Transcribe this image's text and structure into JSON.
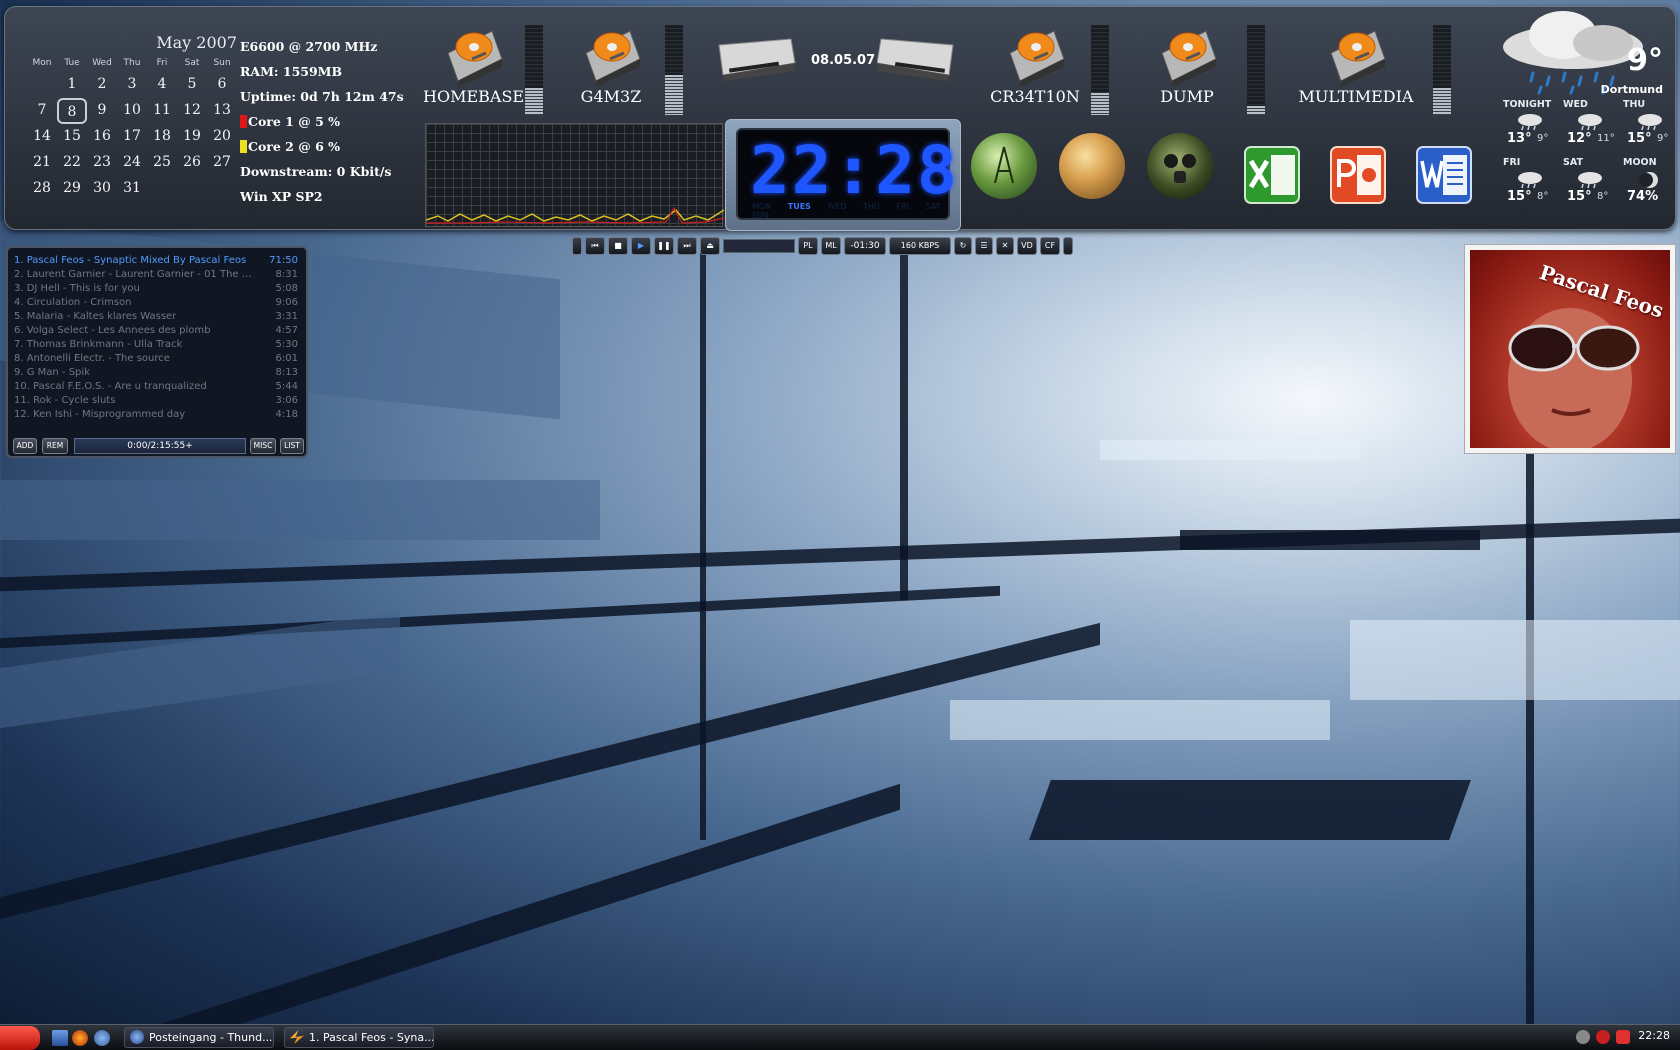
{
  "calendar": {
    "title": "May 2007",
    "weekdays": [
      "Mon",
      "Tue",
      "Wed",
      "Thu",
      "Fri",
      "Sat",
      "Sun"
    ],
    "weeks": [
      [
        "",
        "1",
        "2",
        "3",
        "4",
        "5",
        "6"
      ],
      [
        "7",
        "8",
        "9",
        "10",
        "11",
        "12",
        "13"
      ],
      [
        "14",
        "15",
        "16",
        "17",
        "18",
        "19",
        "20"
      ],
      [
        "21",
        "22",
        "23",
        "24",
        "25",
        "26",
        "27"
      ],
      [
        "28",
        "29",
        "30",
        "31",
        "",
        "",
        ""
      ]
    ],
    "today": "8"
  },
  "sysinfo": {
    "cpu": "E6600 @  2700 MHz",
    "ram": "RAM: 1559MB",
    "uptime": "Uptime: 0d 7h 12m 47s",
    "core1": "Core 1 @ 5 %",
    "core2": "Core 2 @ 6 %",
    "downstream": "Downstream: 0 Kbit/s",
    "os": "Win XP SP2"
  },
  "drives": [
    {
      "label": "HOMEBASE",
      "usage": 0.3
    },
    {
      "label": "G4M3Z",
      "usage": 0.45
    },
    {
      "label": "CR34T10N",
      "usage": 0.25
    },
    {
      "label": "DUMP",
      "usage": 0.1
    },
    {
      "label": "MULTIMEDIA",
      "usage": 0.3
    }
  ],
  "date_short": "08.05.07",
  "clock": {
    "time": "22:28",
    "days": [
      "MON",
      "TUES",
      "WED",
      "THU",
      "FRI",
      "SAT",
      "SUN"
    ],
    "active_day": "TUES"
  },
  "apps": [
    {
      "name": "network-orb-icon"
    },
    {
      "name": "user-avatar-orb-icon"
    },
    {
      "name": "gasmask-orb-icon"
    },
    {
      "name": "excel-icon"
    },
    {
      "name": "powerpoint-icon"
    },
    {
      "name": "word-icon"
    }
  ],
  "weather": {
    "temp": "9°",
    "city": "Dortmund",
    "forecast": [
      {
        "label": "TONIGHT",
        "hi": "13°",
        "lo": "9°"
      },
      {
        "label": "WED",
        "hi": "12°",
        "lo": "11°"
      },
      {
        "label": "THU",
        "hi": "15°",
        "lo": "9°"
      },
      {
        "label": "FRI",
        "hi": "15°",
        "lo": "8°"
      },
      {
        "label": "SAT",
        "hi": "15°",
        "lo": "8°"
      },
      {
        "label": "MOON",
        "hi": "74%",
        "lo": ""
      }
    ]
  },
  "playlist": {
    "items": [
      {
        "title": "1. Pascal Feos - Synaptic Mixed By Pascal Feos",
        "time": "71:50"
      },
      {
        "title": "2. Laurent Garnier - Laurent Garnier - 01 The me...",
        "time": "8:31"
      },
      {
        "title": "3. DJ Hell - This is for you",
        "time": "5:08"
      },
      {
        "title": "4. Circulation - Crimson",
        "time": "9:06"
      },
      {
        "title": "5. Malaria - Kaltes klares Wasser",
        "time": "3:31"
      },
      {
        "title": "6. Volga Select - Les Annees des plomb",
        "time": "4:57"
      },
      {
        "title": "7. Thomas Brinkmann - Ulla Track",
        "time": "5:30"
      },
      {
        "title": "8. Antonelli Electr. - The source",
        "time": "6:01"
      },
      {
        "title": "9. G Man - Spik",
        "time": "8:13"
      },
      {
        "title": "10. Pascal F.E.O.S. - Are u tranqualized",
        "time": "5:44"
      },
      {
        "title": "11. Rok - Cycle sluts",
        "time": "3:06"
      },
      {
        "title": "12. Ken Ishi - Misprogrammed day",
        "time": "4:18"
      }
    ],
    "buttons": {
      "add": "ADD",
      "rem": "REM",
      "misc": "MISC",
      "list": "LIST"
    },
    "total_time": "0:00/2:15:55+"
  },
  "player": {
    "pl": "PL",
    "ml": "ML",
    "elapsed": "-01:30",
    "bitrate": "160 KBPS",
    "vd": "VD",
    "cf": "CF"
  },
  "album": {
    "text": "Pascal Feos"
  },
  "taskbar": {
    "tasks": [
      "Posteingang - Thund...",
      "1. Pascal Feos - Syna..."
    ],
    "time": "22:28"
  }
}
